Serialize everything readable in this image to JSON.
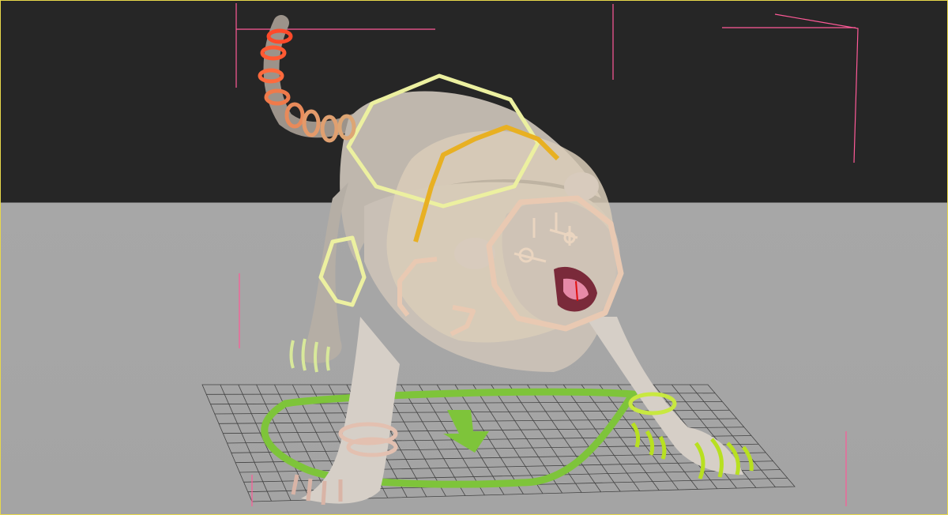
{
  "viewport": {
    "active_border_color": "#e8d84a",
    "background_top": "#262626",
    "floor_color": "#a7a7a7"
  },
  "scene": {
    "objects": [
      {
        "name": "lion-character-mesh",
        "kind": "mesh"
      },
      {
        "name": "tail-controls",
        "color": "#ff6a3d"
      },
      {
        "name": "spine-controls",
        "color": "#ecf0a0"
      },
      {
        "name": "neck-control",
        "color": "#e8b022"
      },
      {
        "name": "head-control",
        "color": "#e9c9b2"
      },
      {
        "name": "front-left-foot-controls",
        "color": "#e3c0b0"
      },
      {
        "name": "front-right-foot-controls",
        "color": "#b8e020"
      },
      {
        "name": "root-control",
        "color": "#7ec43a"
      },
      {
        "name": "floor-grid",
        "color": "#1a1a1a"
      }
    ],
    "selection_bracket_color": "#ff5a98"
  }
}
